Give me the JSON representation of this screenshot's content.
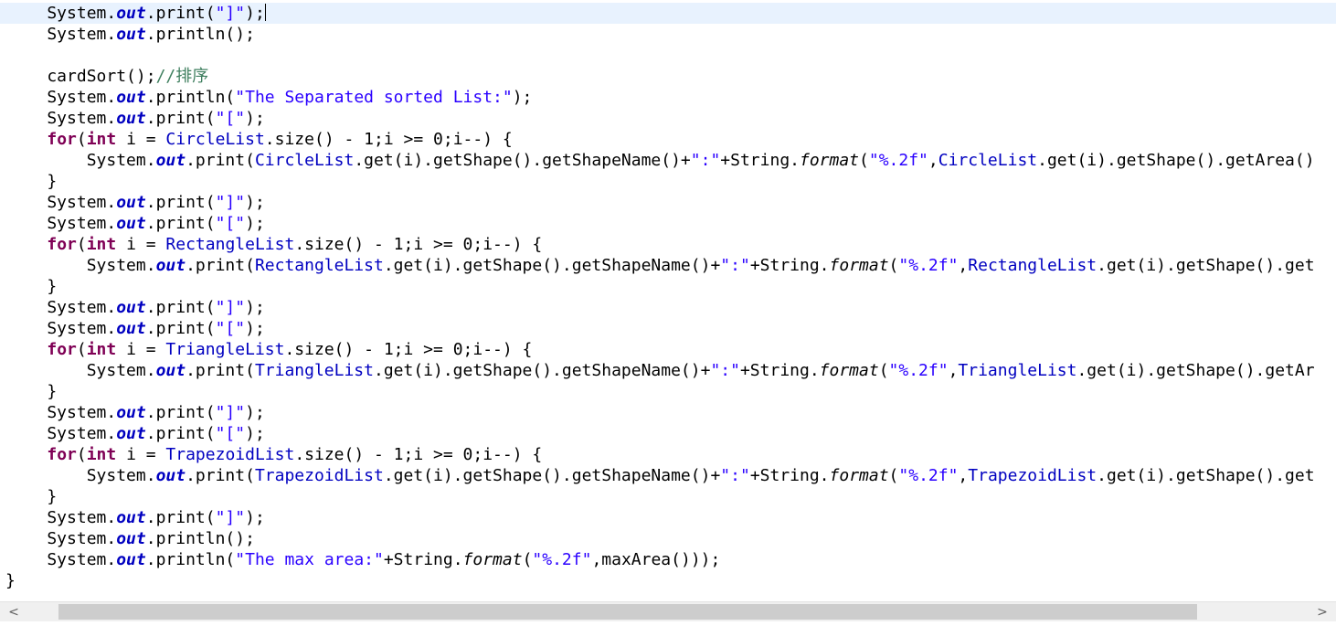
{
  "editor": {
    "lines": {
      "l1": {
        "a": "    System.",
        "b": "out",
        "c": ".print(",
        "d": "\"]\"",
        "e": ");"
      },
      "l2": {
        "a": "    System.",
        "b": "out",
        "c": ".println();"
      },
      "l4": {
        "a": "    cardSort();",
        "b": "//排序"
      },
      "l5": {
        "a": "    System.",
        "b": "out",
        "c": ".println(",
        "d": "\"The Separated sorted List:\"",
        "e": ");"
      },
      "l6": {
        "a": "    System.",
        "b": "out",
        "c": ".print(",
        "d": "\"[\"",
        "e": ");"
      },
      "l7": {
        "a": "    ",
        "b": "for",
        "c": "(",
        "d": "int",
        "e": " i = ",
        "f": "CircleList",
        "g": ".size() - 1;i >= 0;i--) {"
      },
      "l8": {
        "a": "        System.",
        "b": "out",
        "c": ".print(",
        "d": "CircleList",
        "e": ".get(i).getShape().getShapeName()+",
        "f": "\":\"",
        "g": "+String.",
        "h": "format",
        "i": "(",
        "j": "\"%.2f\"",
        "k": ",",
        "l": "CircleList",
        "m": ".get(i).getShape().getArea()"
      },
      "l9": {
        "a": "    }"
      },
      "l10": {
        "a": "    System.",
        "b": "out",
        "c": ".print(",
        "d": "\"]\"",
        "e": ");"
      },
      "l11": {
        "a": "    System.",
        "b": "out",
        "c": ".print(",
        "d": "\"[\"",
        "e": ");"
      },
      "l12": {
        "a": "    ",
        "b": "for",
        "c": "(",
        "d": "int",
        "e": " i = ",
        "f": "RectangleList",
        "g": ".size() - 1;i >= 0;i--) {"
      },
      "l13": {
        "a": "        System.",
        "b": "out",
        "c": ".print(",
        "d": "RectangleList",
        "e": ".get(i).getShape().getShapeName()+",
        "f": "\":\"",
        "g": "+String.",
        "h": "format",
        "i": "(",
        "j": "\"%.2f\"",
        "k": ",",
        "l": "RectangleList",
        "m": ".get(i).getShape().get"
      },
      "l14": {
        "a": "    }"
      },
      "l15": {
        "a": "    System.",
        "b": "out",
        "c": ".print(",
        "d": "\"]\"",
        "e": ");"
      },
      "l16": {
        "a": "    System.",
        "b": "out",
        "c": ".print(",
        "d": "\"[\"",
        "e": ");"
      },
      "l17": {
        "a": "    ",
        "b": "for",
        "c": "(",
        "d": "int",
        "e": " i = ",
        "f": "TriangleList",
        "g": ".size() - 1;i >= 0;i--) {"
      },
      "l18": {
        "a": "        System.",
        "b": "out",
        "c": ".print(",
        "d": "TriangleList",
        "e": ".get(i).getShape().getShapeName()+",
        "f": "\":\"",
        "g": "+String.",
        "h": "format",
        "i": "(",
        "j": "\"%.2f\"",
        "k": ",",
        "l": "TriangleList",
        "m": ".get(i).getShape().getAr"
      },
      "l19": {
        "a": "    }"
      },
      "l20": {
        "a": "    System.",
        "b": "out",
        "c": ".print(",
        "d": "\"]\"",
        "e": ");"
      },
      "l21": {
        "a": "    System.",
        "b": "out",
        "c": ".print(",
        "d": "\"[\"",
        "e": ");"
      },
      "l22": {
        "a": "    ",
        "b": "for",
        "c": "(",
        "d": "int",
        "e": " i = ",
        "f": "TrapezoidList",
        "g": ".size() - 1;i >= 0;i--) {"
      },
      "l23": {
        "a": "        System.",
        "b": "out",
        "c": ".print(",
        "d": "TrapezoidList",
        "e": ".get(i).getShape().getShapeName()+",
        "f": "\":\"",
        "g": "+String.",
        "h": "format",
        "i": "(",
        "j": "\"%.2f\"",
        "k": ",",
        "l": "TrapezoidList",
        "m": ".get(i).getShape().get"
      },
      "l24": {
        "a": "    }"
      },
      "l25": {
        "a": "    System.",
        "b": "out",
        "c": ".print(",
        "d": "\"]\"",
        "e": ");"
      },
      "l26": {
        "a": "    System.",
        "b": "out",
        "c": ".println();"
      },
      "l27": {
        "a": "    System.",
        "b": "out",
        "c": ".println(",
        "d": "\"The max area:\"",
        "e": "+String.",
        "f": "format",
        "g": "(",
        "h": "\"%.2f\"",
        "i": ",maxArea()));"
      },
      "l28": {
        "a": "}"
      }
    }
  },
  "scrollbar": {
    "left_arrow": "<",
    "right_arrow": ">"
  },
  "colors": {
    "keyword": "#7f0055",
    "static_field": "#0000c0",
    "string": "#2a00ff",
    "comment": "#3f7f5f",
    "current_line": "#e8f2fe",
    "scrollbar_track": "#f0f0f0",
    "scrollbar_thumb": "#cdcdcd"
  },
  "icons": {
    "left_arrow": "chevron-left-icon",
    "right_arrow": "chevron-right-icon"
  }
}
